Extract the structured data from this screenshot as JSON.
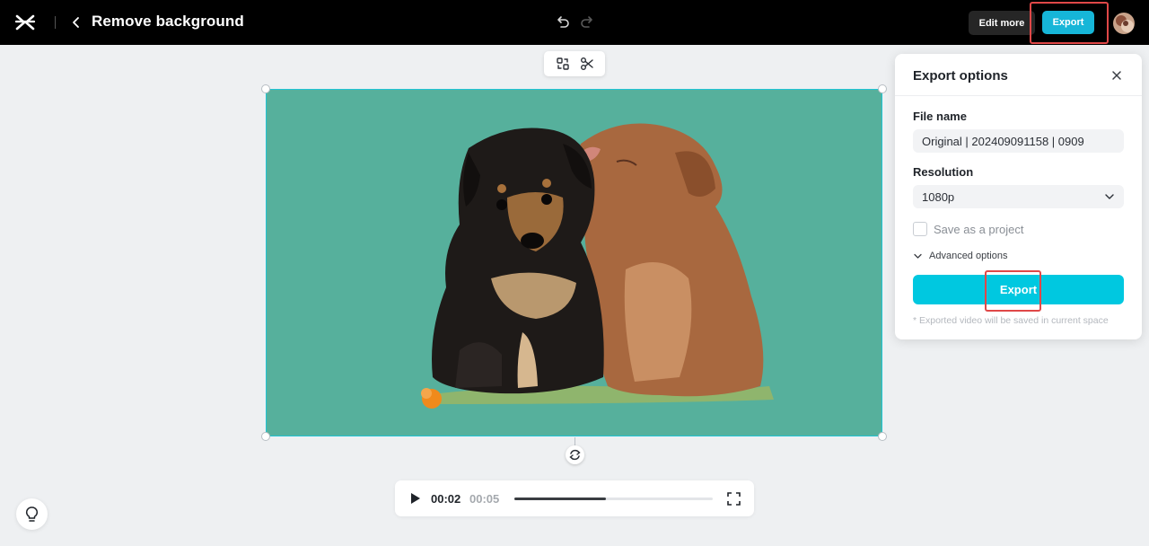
{
  "header": {
    "title": "Remove background",
    "edit_more_label": "Edit more",
    "export_label": "Export"
  },
  "player": {
    "current_time": "00:02",
    "total_time": "00:05",
    "progress_percent": 46
  },
  "export_panel": {
    "title": "Export options",
    "file_name_label": "File name",
    "file_name_value": "Original | 202409091158 | 0909",
    "resolution_label": "Resolution",
    "resolution_value": "1080p",
    "save_project_label": "Save as a project",
    "save_project_checked": false,
    "advanced_label": "Advanced options",
    "export_label": "Export",
    "note": "* Exported video will be saved in current space"
  },
  "colors": {
    "canvas_bg": "#56b09c",
    "accent": "#00c8e0",
    "export_top": "#16b6d8",
    "highlight": "#e04848"
  },
  "icons": [
    "capcut-logo-icon",
    "back-chevron-icon",
    "undo-icon",
    "redo-icon",
    "avatar",
    "replace-icon",
    "scissors-icon",
    "rotate-icon",
    "play-icon",
    "fullscreen-icon",
    "lightbulb-icon",
    "close-icon",
    "chevron-down-icon"
  ]
}
